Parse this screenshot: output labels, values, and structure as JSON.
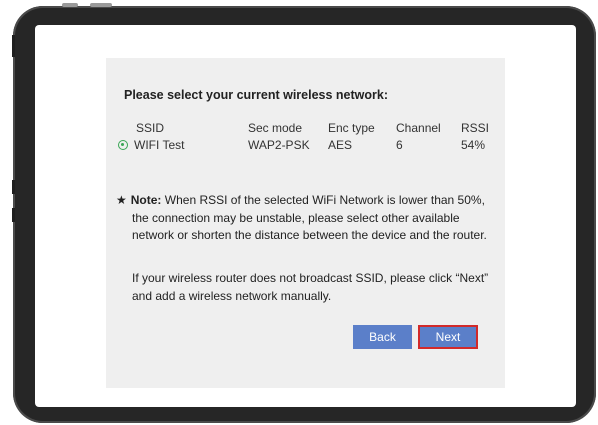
{
  "dialog": {
    "heading": "Please select your current wireless network:",
    "columns": [
      "SSID",
      "Sec mode",
      "Enc type",
      "Channel",
      "RSSI"
    ],
    "networks": [
      {
        "ssid": "WIFI Test",
        "sec_mode": "WAP2-PSK",
        "enc_type": "AES",
        "channel": "6",
        "rssi": "54%",
        "selected": true
      }
    ],
    "note": {
      "star": "★",
      "label": "Note:",
      "text": "When RSSI of the selected WiFi Network is lower than 50%, the connection may be unstable, please select other available network or shorten the distance between the device and the router."
    },
    "info": "If your wireless router does not broadcast SSID, please click “Next” and add a wireless network manually.",
    "back_label": "Back",
    "next_label": "Next"
  },
  "colors": {
    "button": "#5b7fc9",
    "highlight_border": "#d22a2a",
    "radio": "#3aa655",
    "panel": "#efefef"
  }
}
